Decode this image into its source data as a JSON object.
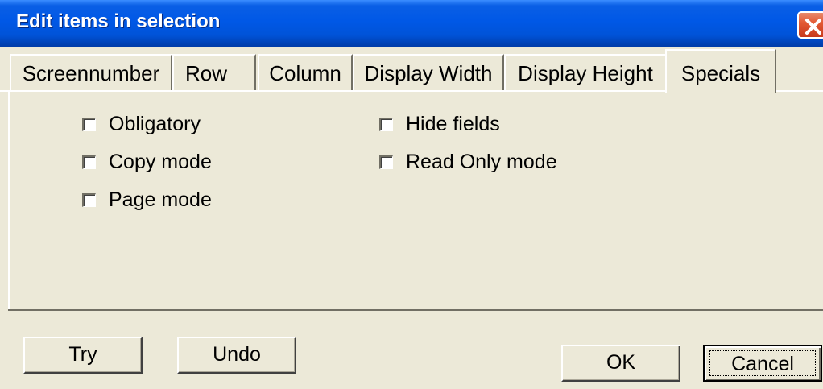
{
  "window": {
    "title": "Edit items in selection"
  },
  "tabs": [
    {
      "label": "Screennumber",
      "active": false
    },
    {
      "label": "Row",
      "active": false
    },
    {
      "label": "Column",
      "active": false
    },
    {
      "label": "Display Width",
      "active": false
    },
    {
      "label": "Display Height",
      "active": false
    },
    {
      "label": "Specials",
      "active": true
    }
  ],
  "options": {
    "left": [
      {
        "label": "Obligatory",
        "checked": false
      },
      {
        "label": "Copy mode",
        "checked": false
      },
      {
        "label": "Page mode",
        "checked": false
      }
    ],
    "right": [
      {
        "label": "Hide fields",
        "checked": false
      },
      {
        "label": "Read Only mode",
        "checked": false
      }
    ]
  },
  "buttons": {
    "try": "Try",
    "undo": "Undo",
    "ok": "OK",
    "cancel": "Cancel"
  },
  "icons": {
    "close": "close-icon"
  }
}
